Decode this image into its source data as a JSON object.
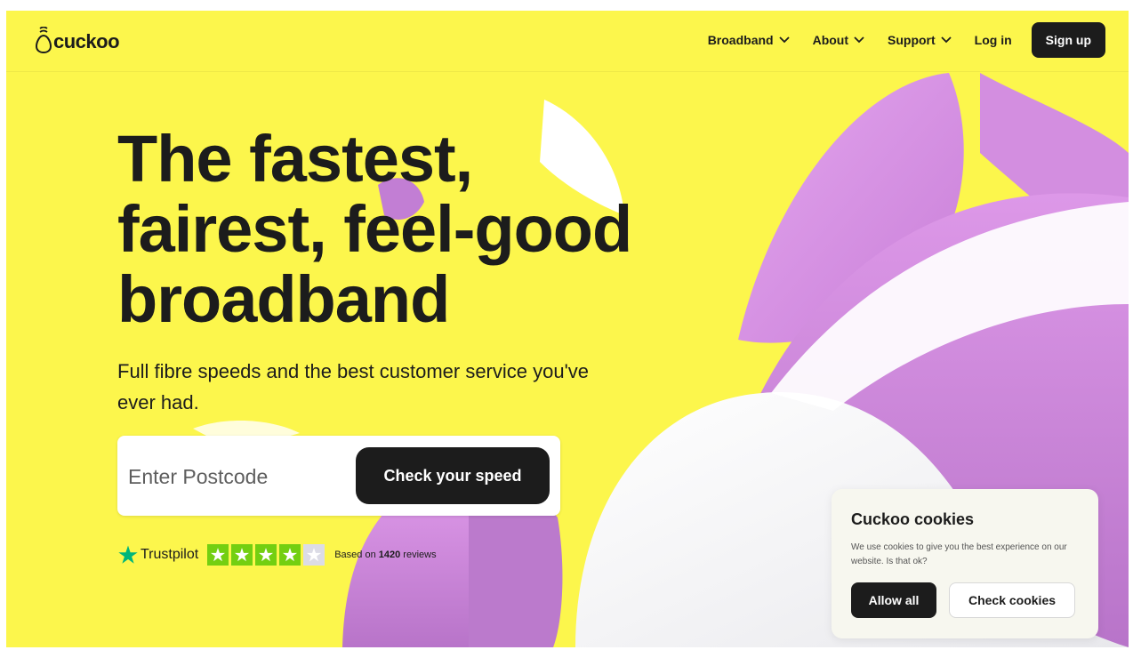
{
  "brand": {
    "name": "cuckoo",
    "logo_icon": "cuckoo-egg-icon"
  },
  "nav": {
    "items": [
      {
        "label": "Broadband",
        "icon": "chevron-down-icon"
      },
      {
        "label": "About",
        "icon": "chevron-down-icon"
      },
      {
        "label": "Support",
        "icon": "chevron-down-icon"
      }
    ],
    "login_label": "Log in",
    "signup_label": "Sign up"
  },
  "hero": {
    "title_lines": [
      "The fastest,",
      "fairest, feel-good",
      "broadband"
    ],
    "subtitle": "Full fibre speeds and the best customer service you've ever had.",
    "postcode_placeholder": "Enter Postcode",
    "postcode_value": "",
    "cta_label": "Check your speed"
  },
  "trustpilot": {
    "name": "Trustpilot",
    "rating_filled_stars": 4,
    "rating_total_stars": 5,
    "reviews_prefix": "Based on",
    "reviews_count": "1420",
    "reviews_suffix": "reviews"
  },
  "cookies": {
    "title": "Cuckoo cookies",
    "text": "We use cookies to give you the best experience on our website. Is that ok?",
    "allow_label": "Allow all",
    "check_label": "Check cookies"
  },
  "colors": {
    "background": "#fcf64c",
    "accent_purple": "#d98fe3",
    "dark": "#1c1c1c",
    "trustpilot_green": "#73cf11",
    "trustpilot_empty": "#dcdce6"
  }
}
